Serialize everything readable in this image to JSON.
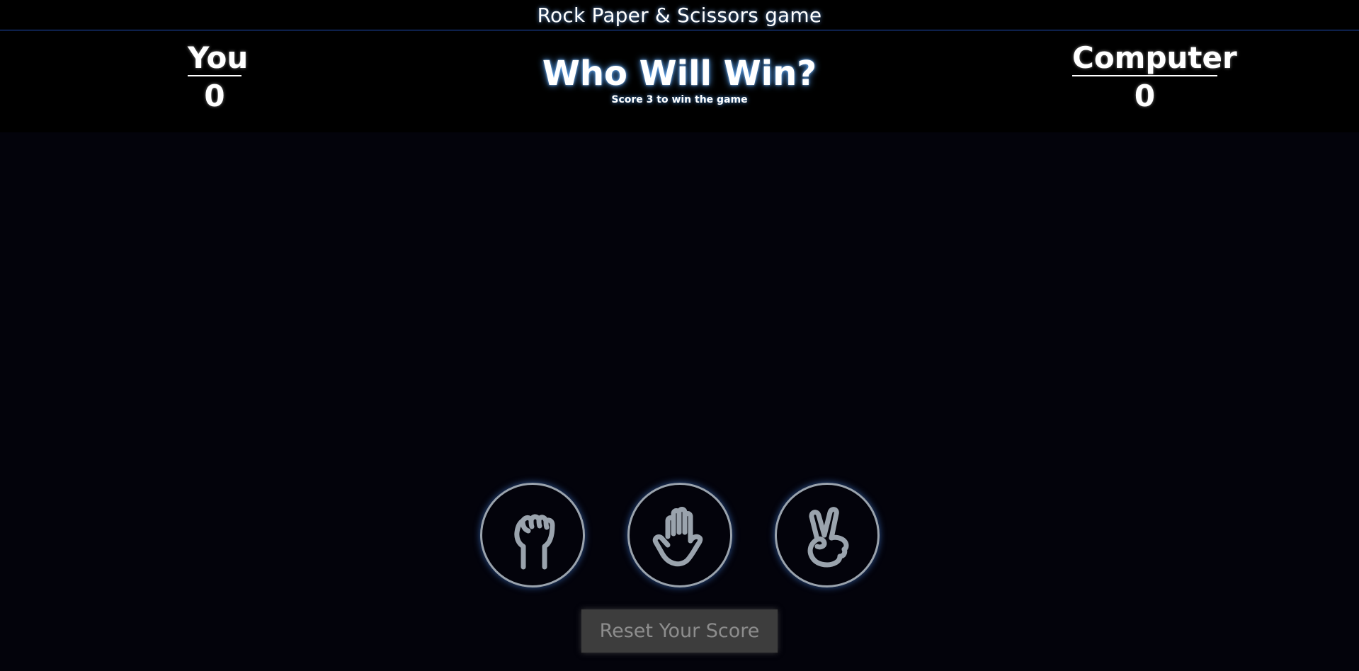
{
  "app": {
    "title": "Rock Paper & Scissors game"
  },
  "scoreboard": {
    "you": {
      "label": "You",
      "score": "0"
    },
    "computer": {
      "label": "Computer",
      "score": "0"
    }
  },
  "message": {
    "headline": "Who Will Win?",
    "subtext": "Score 3 to win the game"
  },
  "choices": [
    {
      "id": "rock",
      "icon": "rock-fist-icon"
    },
    {
      "id": "paper",
      "icon": "paper-hand-icon"
    },
    {
      "id": "scissors",
      "icon": "scissors-hand-icon"
    }
  ],
  "reset": {
    "label": "Reset Your Score"
  },
  "colors": {
    "background": "#03030b",
    "header_bg": "#000000",
    "glow_blue": "#5aaaff",
    "choice_border": "#9aa3ad",
    "reset_bg": "#3d3d3d",
    "reset_text": "#8d8d8d"
  }
}
